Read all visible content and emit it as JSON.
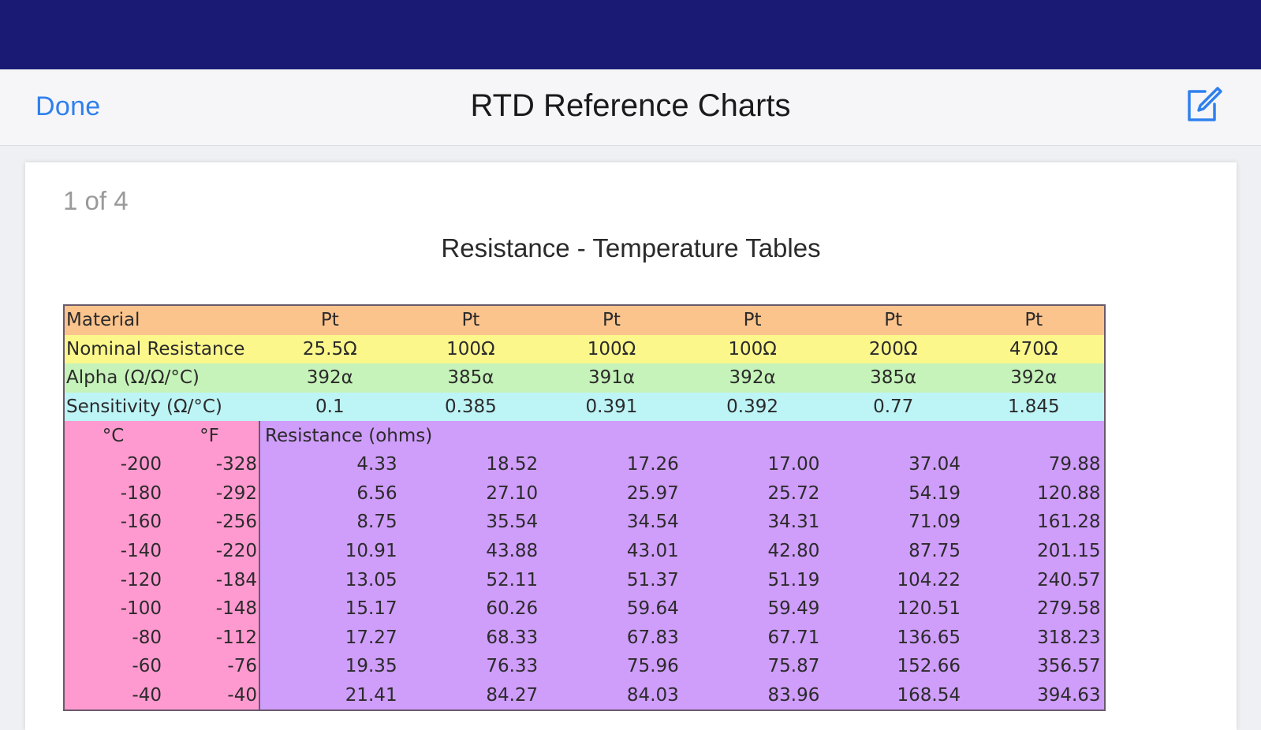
{
  "nav": {
    "done_label": "Done",
    "title": "RTD Reference Charts",
    "edit_icon": "compose-icon"
  },
  "document": {
    "page_counter": "1 of 4",
    "title": "Resistance - Temperature Tables"
  },
  "table": {
    "material": {
      "label": "Material",
      "values": [
        "Pt",
        "Pt",
        "Pt",
        "Pt",
        "Pt",
        "Pt"
      ]
    },
    "nominal": {
      "label": "Nominal Resistance",
      "values": [
        "25.5Ω",
        "100Ω",
        "100Ω",
        "100Ω",
        "200Ω",
        "470Ω"
      ]
    },
    "alpha": {
      "label": "Alpha (Ω/Ω/°C)",
      "values": [
        "392α",
        "385α",
        "391α",
        "392α",
        "385α",
        "392α"
      ]
    },
    "sensitivity": {
      "label": "Sensitivity (Ω/°C)",
      "values": [
        "0.1",
        "0.385",
        "0.391",
        "0.392",
        "0.77",
        "1.845"
      ]
    },
    "temp_header": {
      "c": "°C",
      "f": "°F",
      "resistance_label": "Resistance (ohms)"
    },
    "rows": [
      {
        "c": "-200",
        "f": "-328",
        "r": [
          "4.33",
          "18.52",
          "17.26",
          "17.00",
          "37.04",
          "79.88"
        ]
      },
      {
        "c": "-180",
        "f": "-292",
        "r": [
          "6.56",
          "27.10",
          "25.97",
          "25.72",
          "54.19",
          "120.88"
        ]
      },
      {
        "c": "-160",
        "f": "-256",
        "r": [
          "8.75",
          "35.54",
          "34.54",
          "34.31",
          "71.09",
          "161.28"
        ]
      },
      {
        "c": "-140",
        "f": "-220",
        "r": [
          "10.91",
          "43.88",
          "43.01",
          "42.80",
          "87.75",
          "201.15"
        ]
      },
      {
        "c": "-120",
        "f": "-184",
        "r": [
          "13.05",
          "52.11",
          "51.37",
          "51.19",
          "104.22",
          "240.57"
        ]
      },
      {
        "c": "-100",
        "f": "-148",
        "r": [
          "15.17",
          "60.26",
          "59.64",
          "59.49",
          "120.51",
          "279.58"
        ]
      },
      {
        "c": "-80",
        "f": "-112",
        "r": [
          "17.27",
          "68.33",
          "67.83",
          "67.71",
          "136.65",
          "318.23"
        ]
      },
      {
        "c": "-60",
        "f": "-76",
        "r": [
          "19.35",
          "76.33",
          "75.96",
          "75.87",
          "152.66",
          "356.57"
        ]
      },
      {
        "c": "-40",
        "f": "-40",
        "r": [
          "21.41",
          "84.27",
          "84.03",
          "83.96",
          "168.54",
          "394.63"
        ]
      }
    ]
  },
  "colors": {
    "status_bar": "#1a1a75",
    "accent": "#2f80ed",
    "material_row": "#fbc48d",
    "nominal_row": "#fbf78b",
    "alpha_row": "#c6f3b9",
    "sensitivity_row": "#bdf4f6",
    "temperature_column": "#ff9ad0",
    "resistance_area": "#cf9dfa"
  }
}
